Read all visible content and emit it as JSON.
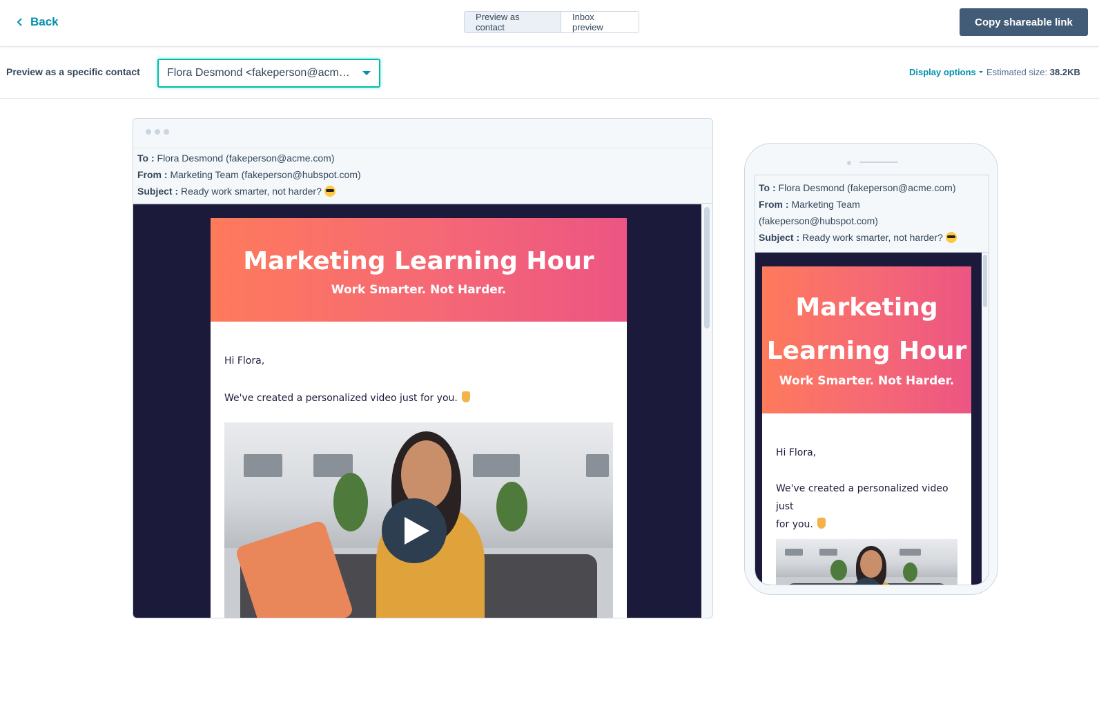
{
  "topbar": {
    "back_label": "Back",
    "tabs": [
      {
        "label": "Preview as contact",
        "active": true
      },
      {
        "label": "Inbox preview",
        "active": false
      }
    ],
    "copy_link_label": "Copy shareable link"
  },
  "subbar": {
    "preview_label": "Preview as a specific contact",
    "contact_value": "Flora Desmond <fakeperson@acme.com>",
    "display_options_label": "Display options",
    "estimated_size_label": "Estimated size:",
    "estimated_size_value": "38.2KB"
  },
  "email": {
    "to_label": "To :",
    "to_value": "Flora Desmond (fakeperson@acme.com)",
    "from_label": "From :",
    "from_value": "Marketing Team (fakeperson@hubspot.com)",
    "mobile_from_value_line1": "Marketing Team",
    "mobile_from_value_line2": "(fakeperson@hubspot.com)",
    "subject_label": "Subject :",
    "subject_value": "Ready work smarter, not harder?",
    "hero_title": "Marketing Learning Hour",
    "mobile_hero_title_line1": "Marketing",
    "mobile_hero_title_line2": "Learning Hour",
    "hero_subtitle": "Work Smarter. Not Harder.",
    "greeting": "Hi Flora,",
    "body_line": "We've created a personalized video just for you.",
    "mobile_body_line1": "We've created a personalized video just",
    "mobile_body_line2": "for you."
  },
  "icons": {
    "back": "chevron-left-icon",
    "dropdown": "caret-down-icon",
    "play": "play-icon",
    "subject_emoji": "sunglasses-face-emoji",
    "body_emoji": "pointing-down-hand-emoji"
  },
  "colors": {
    "accent": "#0091ae",
    "primary_button": "#425b76",
    "focus_border": "#00bda5",
    "email_background": "#1b1a3a",
    "hero_gradient_start": "#fe7a5b",
    "hero_gradient_end": "#ec5583"
  }
}
